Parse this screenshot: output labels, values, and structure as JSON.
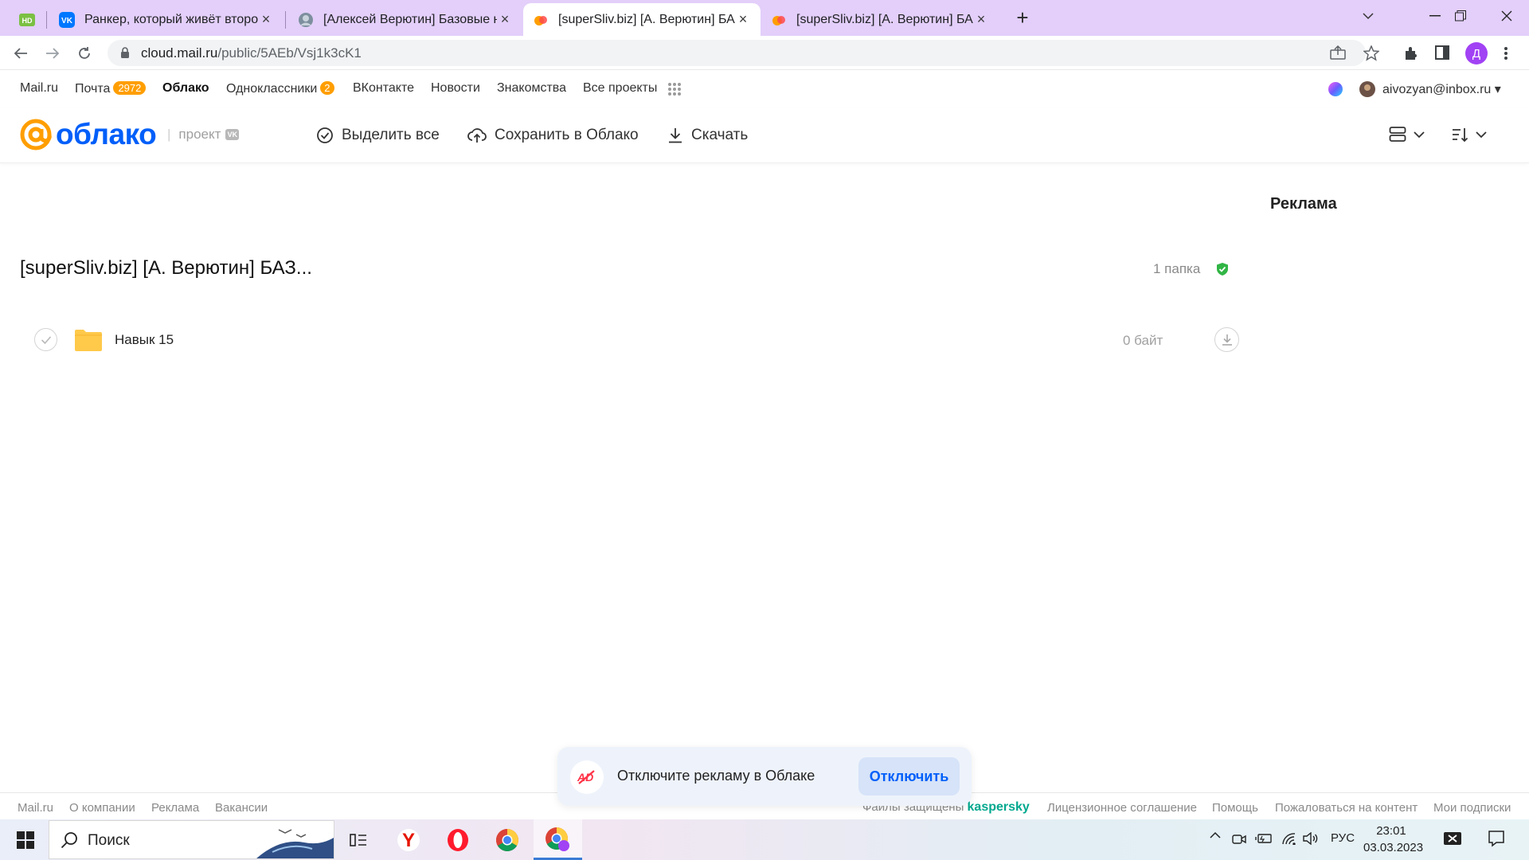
{
  "browser": {
    "tabs": [
      {
        "title": "",
        "favicon": "hd-icon"
      },
      {
        "title": "Ранкер, который живёт второй",
        "favicon": "vk-icon"
      },
      {
        "title": "[Алексей Верютин] Базовые на",
        "favicon": "avatar-icon"
      },
      {
        "title": "[superSliv.biz] [А. Верютин] БАЗ",
        "favicon": "cloud-icon",
        "active": true
      },
      {
        "title": "[superSliv.biz] [А. Верютин] БАЗ",
        "favicon": "cloud-icon"
      }
    ],
    "url_host": "cloud.mail.ru",
    "url_path": "/public/5AEb/Vsj1k3cK1",
    "profile_initial": "Д"
  },
  "portal": {
    "links": [
      {
        "label": "Mail.ru"
      },
      {
        "label": "Почта",
        "badge": "2972"
      },
      {
        "label": "Облако",
        "active": true
      },
      {
        "label": "Одноклассники",
        "badge": "2"
      },
      {
        "label": "ВКонтакте"
      },
      {
        "label": "Новости"
      },
      {
        "label": "Знакомства"
      },
      {
        "label": "Все проекты"
      }
    ],
    "user_email": "aivozyan@inbox.ru"
  },
  "cloud": {
    "brand": "облако",
    "project_label": "проект",
    "vk_badge": "VK",
    "toolbar": {
      "select_all": "Выделить все",
      "save_to_cloud": "Сохранить в Облако",
      "download": "Скачать"
    }
  },
  "content": {
    "ad_label": "Реклама",
    "folder_title": "[superSliv.biz] [А. Верютин] БАЗ...",
    "folder_count": "1 папка",
    "items": [
      {
        "name": "Навык 15",
        "size": "0 байт",
        "type": "folder"
      }
    ]
  },
  "footer": {
    "left_links": [
      "Mail.ru",
      "О компании",
      "Реклама",
      "Вакансии"
    ],
    "protected_label": "Файлы защищены",
    "kaspersky": "kaspersky",
    "right_links": [
      "Лицензионное соглашение",
      "Помощь",
      "Пожаловаться на контент",
      "Мои подписки"
    ]
  },
  "popup": {
    "text": "Отключите рекламу в Облаке",
    "button": "Отключить"
  },
  "taskbar": {
    "search_label": "Поиск",
    "language": "РУС",
    "time": "23:01",
    "date": "03.03.2023"
  },
  "colors": {
    "brand_blue": "#005ff9",
    "brand_orange": "#ff9e00",
    "tabstrip": "#e3cffa",
    "verified_green": "#31b545",
    "folder_yellow": "#ffc94a"
  }
}
